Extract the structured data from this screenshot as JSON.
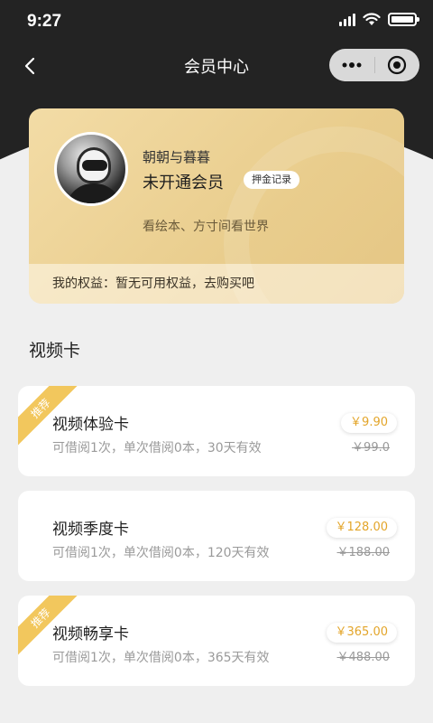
{
  "status_bar": {
    "time": "9:27"
  },
  "nav": {
    "title": "会员中心"
  },
  "member": {
    "nickname": "朝朝与暮暮",
    "status": "未开通会员",
    "deposit_label": "押金记录",
    "slogan": "看绘本、方寸间看世界",
    "benefits": "我的权益：暂无可用权益，去购买吧"
  },
  "section": {
    "title": "视频卡"
  },
  "cards": [
    {
      "badge": "推荐",
      "title": "视频体验卡",
      "desc": "可借阅1次，单次借阅0本，30天有效",
      "price": "￥9.90",
      "original_price": "￥99.0"
    },
    {
      "badge": "",
      "title": "视频季度卡",
      "desc": "可借阅1次，单次借阅0本，120天有效",
      "price": "￥128.00",
      "original_price": "￥188.00"
    },
    {
      "badge": "推荐",
      "title": "视频畅享卡",
      "desc": "可借阅1次，单次借阅0本，365天有效",
      "price": "￥365.00",
      "original_price": "￥488.00"
    }
  ],
  "colors": {
    "accent": "#e3a52a",
    "ribbon": "#f2c75d",
    "header_dark": "#232323",
    "card_gold": "#e9cd8d"
  },
  "icons": {
    "back": "chevron-left-icon",
    "more": "more-dots-icon",
    "close": "target-close-icon"
  }
}
